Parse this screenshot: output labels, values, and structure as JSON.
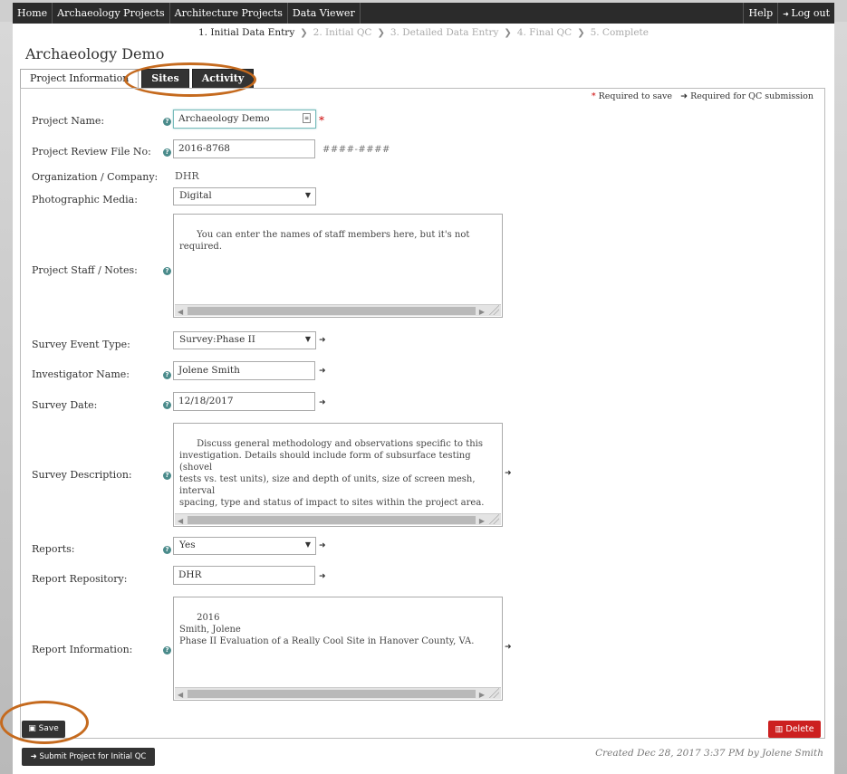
{
  "nav": {
    "left": [
      "Home",
      "Archaeology Projects",
      "Architecture Projects",
      "Data Viewer"
    ],
    "help": "Help",
    "logout": "Log out"
  },
  "steps": [
    {
      "label": "1. Initial Data Entry",
      "active": true
    },
    {
      "label": "2. Initial QC",
      "active": false
    },
    {
      "label": "3. Detailed Data Entry",
      "active": false
    },
    {
      "label": "4. Final QC",
      "active": false
    },
    {
      "label": "5. Complete",
      "active": false
    }
  ],
  "page_title": "Archaeology Demo",
  "tabs": {
    "project_info": "Project Information",
    "sites": "Sites",
    "activity": "Activity"
  },
  "legend": {
    "required_save": "Required to save",
    "required_qc": "Required for QC submission"
  },
  "form": {
    "project_name": {
      "label": "Project Name:",
      "value": "Archaeology Demo"
    },
    "review_file_no": {
      "label": "Project Review File No:",
      "value": "2016-8768",
      "hint": "####-####"
    },
    "organization": {
      "label": "Organization / Company:",
      "value": "DHR"
    },
    "photo_media": {
      "label": "Photographic Media:",
      "value": "Digital"
    },
    "staff_notes": {
      "label": "Project Staff / Notes:",
      "value": "You can enter the names of staff members here, but it's not required."
    },
    "survey_event_type": {
      "label": "Survey Event Type:",
      "value": "Survey:Phase II"
    },
    "investigator": {
      "label": "Investigator Name:",
      "value": "Jolene Smith"
    },
    "survey_date": {
      "label": "Survey Date:",
      "value": "12/18/2017"
    },
    "survey_description": {
      "label": "Survey Description:",
      "value": "Discuss general methodology and observations specific to this\ninvestigation. Details should include form of subsurface testing (shovel\ntests vs. test units), size and depth of units, size of screen mesh, interval\nspacing, type and status of impact to sites within the project area."
    },
    "reports": {
      "label": "Reports:",
      "value": "Yes"
    },
    "report_repository": {
      "label": "Report Repository:",
      "value": "DHR"
    },
    "report_information": {
      "label": "Report Information:",
      "value": "2016\nSmith, Jolene\nPhase II Evaluation of a Really Cool Site in Hanover County, VA."
    }
  },
  "buttons": {
    "save": "Save",
    "delete": "Delete",
    "submit": "Submit Project for Initial QC"
  },
  "created": "Created Dec 28, 2017 3:37 PM by Jolene Smith",
  "colors": {
    "nav_bg": "#2b2b2b",
    "delete_red": "#cc2020",
    "annotation_orange": "#c56a1e",
    "required_red": "#cc0000"
  }
}
